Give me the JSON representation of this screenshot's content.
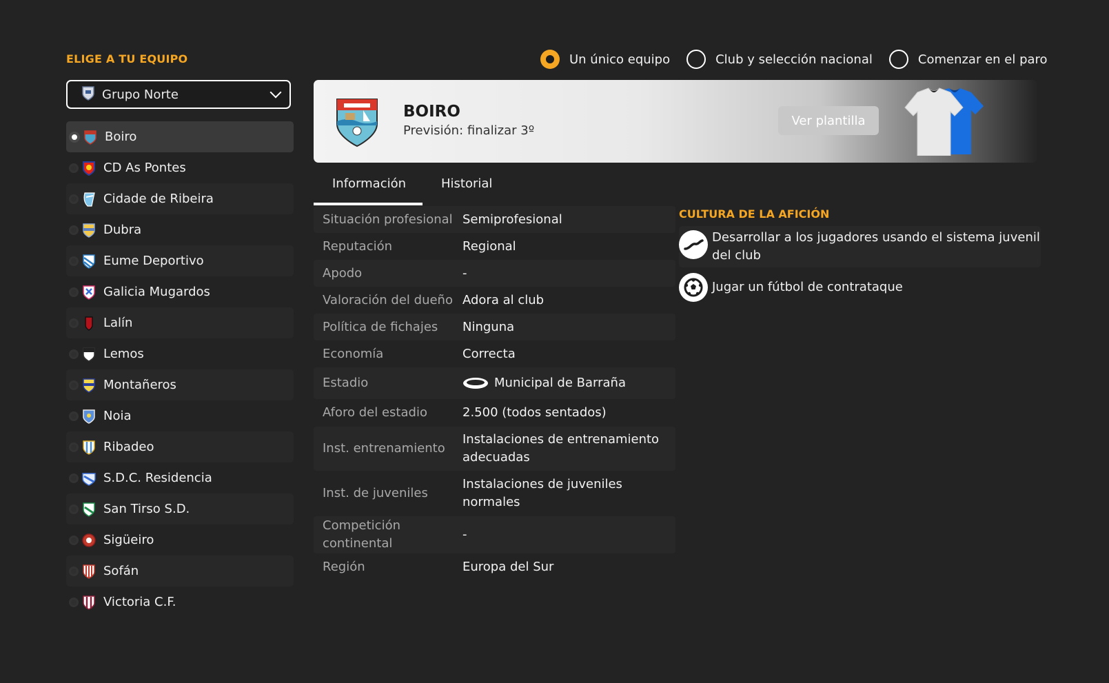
{
  "left_title": "ELIGE A TU EQUIPO",
  "group_select": {
    "value": "Grupo Norte"
  },
  "teams": [
    {
      "name": "Boiro",
      "selected": true
    },
    {
      "name": "CD As Pontes"
    },
    {
      "name": "Cidade de Ribeira"
    },
    {
      "name": "Dubra"
    },
    {
      "name": "Eume Deportivo"
    },
    {
      "name": "Galicia Mugardos"
    },
    {
      "name": "Lalín"
    },
    {
      "name": "Lemos"
    },
    {
      "name": "Montañeros"
    },
    {
      "name": "Noia"
    },
    {
      "name": "Ribadeo"
    },
    {
      "name": "S.D.C. Residencia"
    },
    {
      "name": "San Tirso S.D."
    },
    {
      "name": "Sigüeiro"
    },
    {
      "name": "Sofán"
    },
    {
      "name": "Victoria C.F."
    }
  ],
  "modes": [
    {
      "label": "Un único equipo",
      "selected": true
    },
    {
      "label": "Club y selección nacional"
    },
    {
      "label": "Comenzar en el paro"
    }
  ],
  "club": {
    "name": "BOIRO",
    "forecast": "Previsión: finalizar 3º",
    "squad_button": "Ver plantilla"
  },
  "tabs": {
    "info": "Información",
    "history": "Historial"
  },
  "info_rows": [
    {
      "label": "Situación profesional",
      "value": "Semiprofesional"
    },
    {
      "label": "Reputación",
      "value": "Regional"
    },
    {
      "label": "Apodo",
      "value": "-"
    },
    {
      "label": "Valoración del dueño",
      "value": "Adora al club"
    },
    {
      "label": "Política de fichajes",
      "value": "Ninguna"
    },
    {
      "label": "Economía",
      "value": "Correcta"
    },
    {
      "label": "Estadio",
      "value": "Municipal de Barraña"
    },
    {
      "label": "Aforo del estadio",
      "value": "2.500 (todos sentados)"
    },
    {
      "label": "Inst. entrenamiento",
      "value": "Instalaciones de entrenamiento adecuadas"
    },
    {
      "label": "Inst. de juveniles",
      "value": "Instalaciones de juveniles normales"
    },
    {
      "label": "Competición continental",
      "value": "-"
    },
    {
      "label": "Región",
      "value": "Europa del Sur"
    }
  ],
  "culture": {
    "title": "CULTURA DE LA AFICIÓN",
    "items": [
      {
        "text": "Desarrollar a los jugadores usando el sistema juvenil del club",
        "icon": "growth-curve-icon"
      },
      {
        "text": "Jugar un fútbol de contrataque",
        "icon": "football-icon"
      }
    ]
  },
  "colors": {
    "accent": "#f5a623",
    "background": "#232324"
  }
}
